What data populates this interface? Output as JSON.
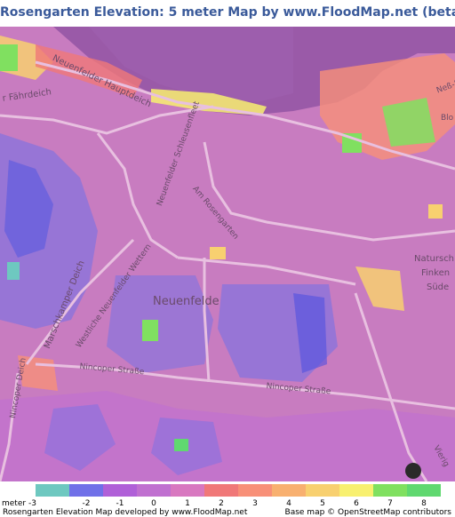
{
  "title": "Rosengarten Elevation: 5 meter Map by www.FloodMap.net (beta)",
  "map_labels": {
    "neuenfelde": "Neuenfelde",
    "neuenfelder_hauptdeich": "Neuenfelder Hauptdeich",
    "fahrdeich": "r Fährdeich",
    "neuenfelder_schleusenfleet": "Neuenfelder Schleusenfleet",
    "am_rosengarten": "Am Rosengarten",
    "marschkamper_deich": "Marschkamper Deich",
    "westliche_neuenfelder_wettern": "Westliche Neuenfelder Wettern",
    "nincoper_strasse_1": "Nincoper Straße",
    "nincoper_strasse_2": "Nincoper Straße",
    "nincoper_deich": "Nincoper Deich",
    "ness": "Neß-H",
    "blo": "Blo",
    "natursch": "Natursch",
    "finken": "Finken",
    "sued": "Süde",
    "vierig": "Vierig"
  },
  "legend": {
    "unit_label": "meter",
    "items": [
      {
        "label": "-3",
        "color": "#6ec8c0"
      },
      {
        "label": "-2",
        "color": "#7070e8"
      },
      {
        "label": "-1",
        "color": "#b060d8"
      },
      {
        "label": "0",
        "color": "#c070d0"
      },
      {
        "label": "1",
        "color": "#d878c0"
      },
      {
        "label": "2",
        "color": "#f07878"
      },
      {
        "label": "3",
        "color": "#f89078"
      },
      {
        "label": "4",
        "color": "#f8b070"
      },
      {
        "label": "5",
        "color": "#f8d070"
      },
      {
        "label": "6",
        "color": "#f8f070"
      },
      {
        "label": "7",
        "color": "#80e060"
      },
      {
        "label": "8",
        "color": "#60d870"
      }
    ],
    "first_label": "-3"
  },
  "credits": {
    "left": "Rosengarten Elevation Map developed by www.FloodMap.net",
    "right": "Base map © OpenStreetMap contributors"
  }
}
